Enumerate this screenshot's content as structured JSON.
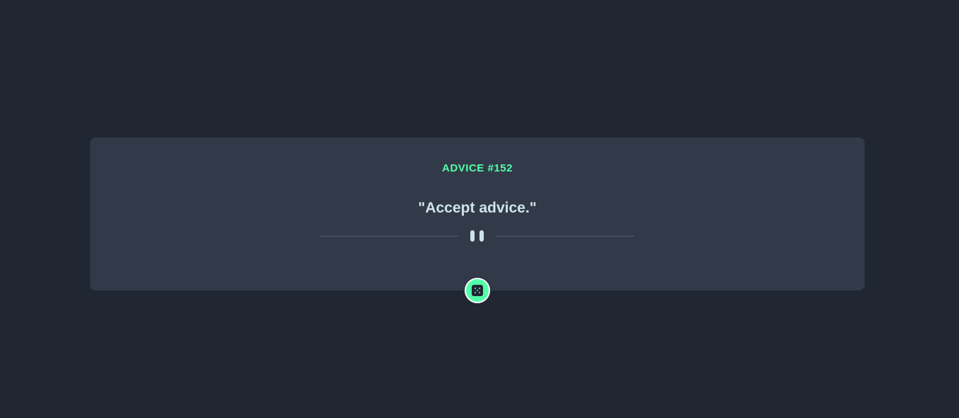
{
  "advice": {
    "id_label": "ADVICE #152",
    "text": "\"Accept advice.\""
  },
  "divider": {
    "icon": "pause-icon"
  },
  "button": {
    "icon": "dice-icon",
    "color": "#52ffa8"
  },
  "colors": {
    "background": "#202632",
    "card": "#323a49",
    "accent": "#52ffa8",
    "text": "#cee3e9",
    "divider": "#4f5d74"
  }
}
